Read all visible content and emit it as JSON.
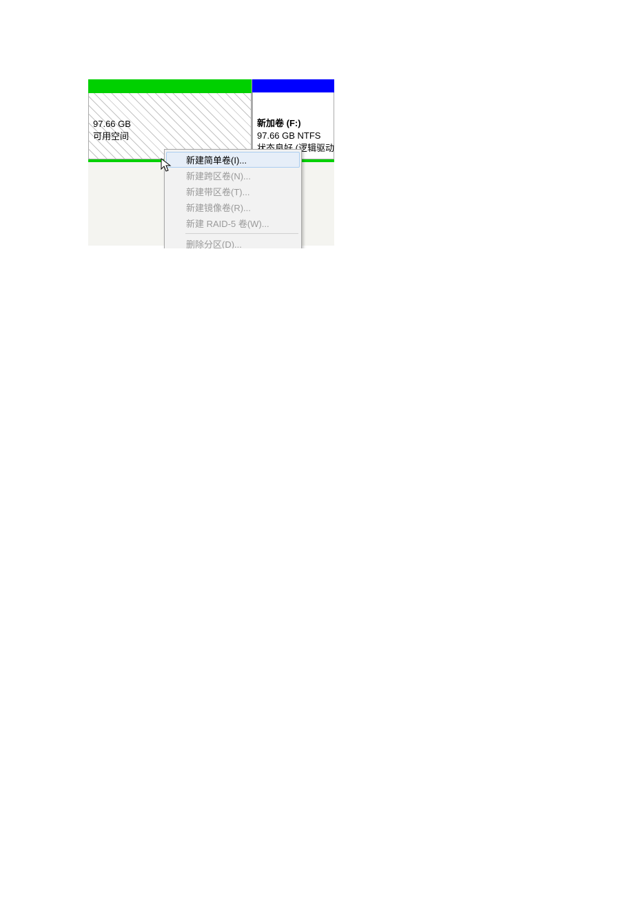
{
  "partition_free": {
    "size": "97.66 GB",
    "status": "可用空间"
  },
  "partition_volume": {
    "title": "新加卷  (F:)",
    "size": "97.66 GB NTFS",
    "status": "状态良好 (逻辑驱动"
  },
  "menu": {
    "new_simple": "新建简单卷(I)...",
    "new_spanned": "新建跨区卷(N)...",
    "new_striped": "新建带区卷(T)...",
    "new_mirror": "新建镜像卷(R)...",
    "new_raid5": "新建 RAID-5 卷(W)...",
    "delete_partition": "删除分区(D)..."
  }
}
